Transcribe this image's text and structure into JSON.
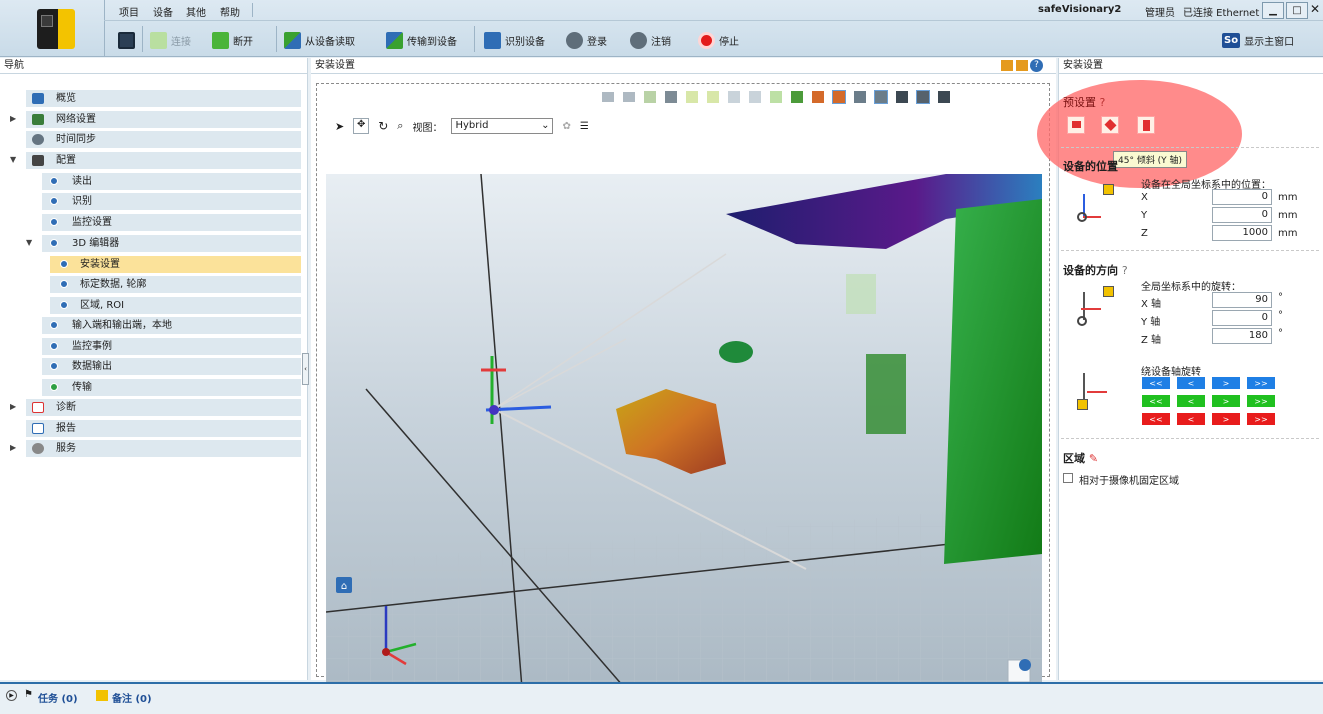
{
  "app": {
    "menu": [
      "项目",
      "设备",
      "其他",
      "帮助"
    ],
    "device_name": "safeVisionary2",
    "role": "管理员",
    "connection": "已连接 Ethernet",
    "window_buttons": [
      "▁",
      "□",
      "✕"
    ]
  },
  "toolbar": {
    "connect": "连接",
    "disconnect": "断开",
    "read_from_device": "从设备读取",
    "transfer_to_device": "传输到设备",
    "identify_device": "识别设备",
    "login": "登录",
    "logout": "注销",
    "stop": "停止",
    "show_main_window": "显示主窗口",
    "so_badge": "So"
  },
  "nav": {
    "title": "导航",
    "items": [
      {
        "label": "概览"
      },
      {
        "label": "网络设置"
      },
      {
        "label": "时间同步"
      },
      {
        "label": "配置"
      },
      {
        "label": "读出"
      },
      {
        "label": "识别"
      },
      {
        "label": "监控设置"
      },
      {
        "label": "3D 编辑器"
      },
      {
        "label": "安装设置"
      },
      {
        "label": "标定数据, 轮廓"
      },
      {
        "label": "区域, ROI"
      },
      {
        "label": "输入端和输出端，本地"
      },
      {
        "label": "监控事例"
      },
      {
        "label": "数据输出"
      },
      {
        "label": "传输"
      },
      {
        "label": "诊断"
      },
      {
        "label": "报告"
      },
      {
        "label": "服务"
      }
    ]
  },
  "center": {
    "title": "安装设置",
    "view_label": "视图：",
    "view_value": "Hybrid"
  },
  "right": {
    "title": "安装设置",
    "presets_title": "预设置",
    "tooltip": "45° 倾斜 (Y 轴)",
    "position_title": "设备的位置",
    "position_caption": "设备在全局坐标系中的位置：",
    "position": [
      {
        "axis": "X",
        "value": "0",
        "unit": "mm"
      },
      {
        "axis": "Y",
        "value": "0",
        "unit": "mm"
      },
      {
        "axis": "Z",
        "value": "1000",
        "unit": "mm"
      }
    ],
    "orientation_title": "设备的方向",
    "orientation_caption": "全局坐标系中的旋转：",
    "orientation": [
      {
        "axis": "X 轴",
        "value": "90",
        "unit": "°"
      },
      {
        "axis": "Y 轴",
        "value": "0",
        "unit": "°"
      },
      {
        "axis": "Z 轴",
        "value": "180",
        "unit": "°"
      }
    ],
    "rotate_caption": "绕设备轴旋转",
    "rotate_buttons": [
      "<<",
      "<",
      ">",
      ">>"
    ],
    "rotate_colors": [
      "#1f7fe5",
      "#20c020",
      "#e81c1c"
    ],
    "region_title": "区域",
    "region_checkbox": "相对于摄像机固定区域"
  },
  "status": {
    "tasks": "任务 (0)",
    "notes": "备注 (0)"
  },
  "colors": {
    "nav_row": "#dde8ef",
    "nav_selected": "#fbe29a",
    "accent_blue": "#2d6ea8",
    "highlight_red": "#ff6a6a"
  }
}
